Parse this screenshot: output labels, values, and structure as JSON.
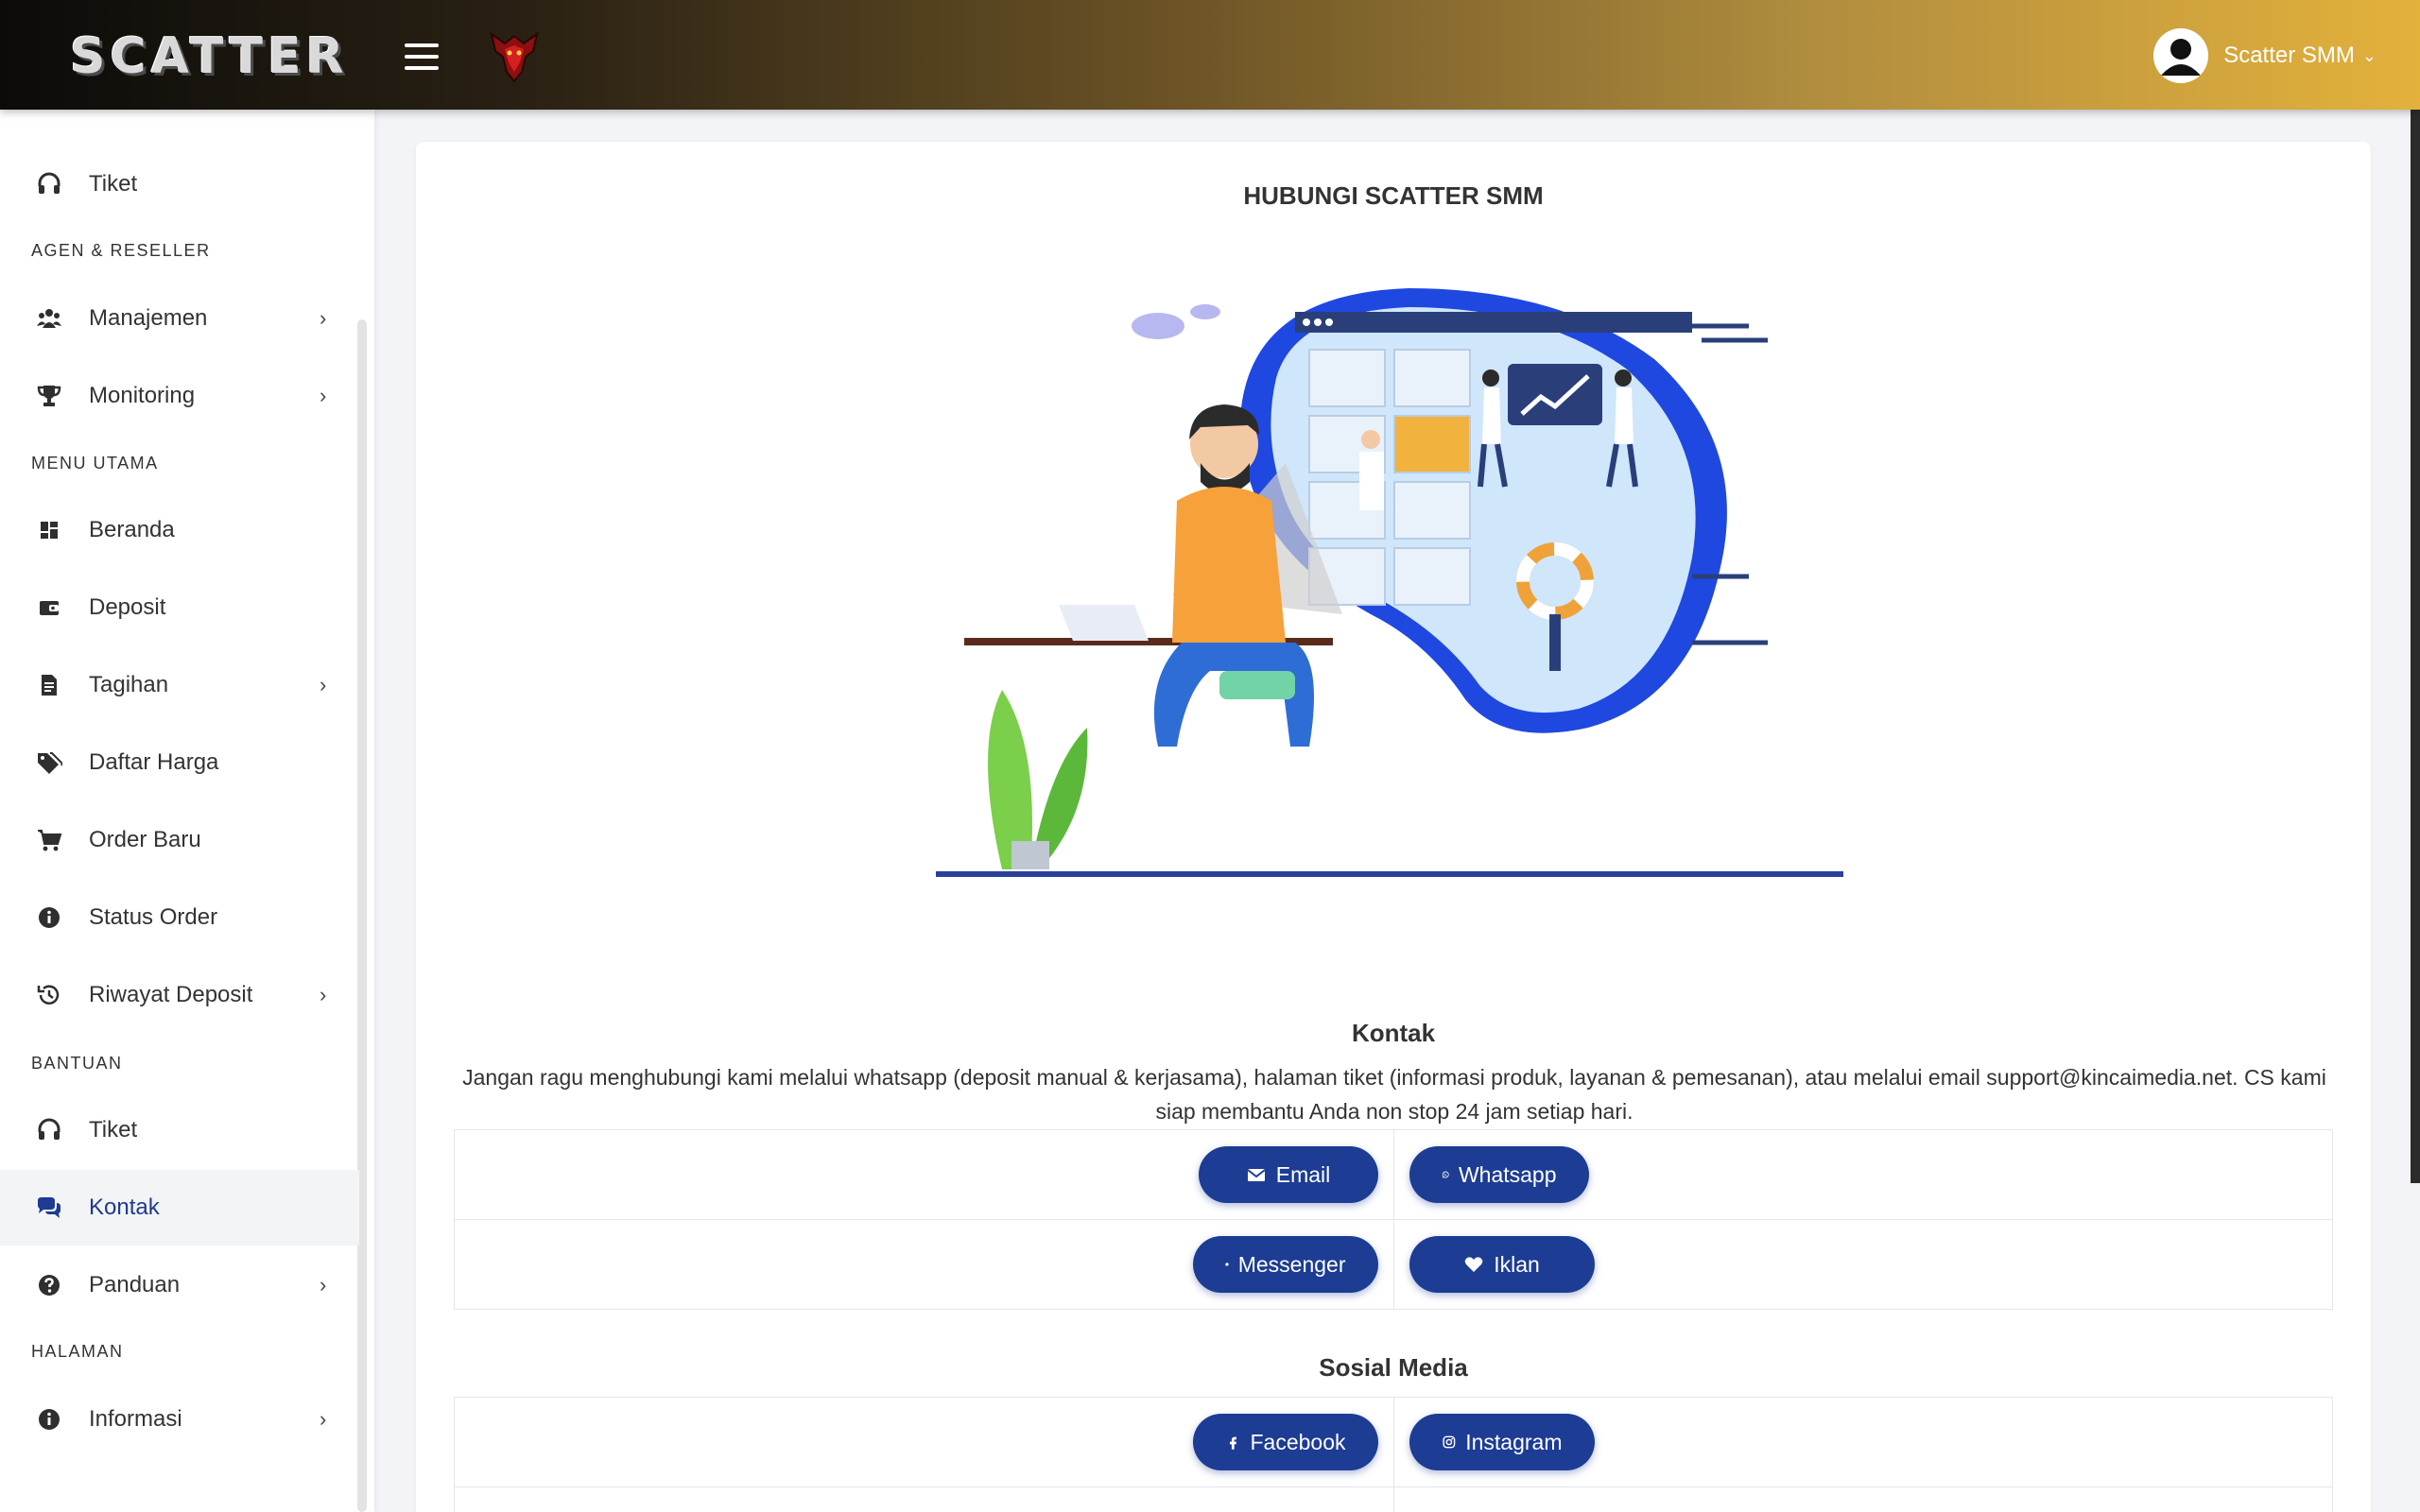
{
  "app": {
    "brand": "SCATTER",
    "user_name": "Scatter SMM"
  },
  "sidebar": {
    "items": [
      {
        "label": "Tiket",
        "icon": "headset-icon"
      },
      {
        "label": "Manajemen",
        "icon": "users-icon",
        "has_children": true
      },
      {
        "label": "Monitoring",
        "icon": "trophy-icon",
        "has_children": true
      },
      {
        "label": "Beranda",
        "icon": "dashboard-icon"
      },
      {
        "label": "Deposit",
        "icon": "wallet-icon"
      },
      {
        "label": "Tagihan",
        "icon": "invoice-icon",
        "has_children": true
      },
      {
        "label": "Daftar Harga",
        "icon": "tags-icon"
      },
      {
        "label": "Order Baru",
        "icon": "cart-icon"
      },
      {
        "label": "Status Order",
        "icon": "info-icon"
      },
      {
        "label": "Riwayat Deposit",
        "icon": "history-icon",
        "has_children": true
      },
      {
        "label": "Tiket",
        "icon": "headset-icon"
      },
      {
        "label": "Kontak",
        "icon": "chat-icon",
        "active": true
      },
      {
        "label": "Panduan",
        "icon": "question-icon",
        "has_children": true
      },
      {
        "label": "Informasi",
        "icon": "info-icon",
        "has_children": true
      }
    ],
    "headings": [
      "AGEN & RESELLER",
      "MENU UTAMA",
      "BANTUAN",
      "HALAMAN"
    ]
  },
  "main": {
    "title": "HUBUNGI SCATTER SMM",
    "contact": {
      "title": "Kontak",
      "text": "Jangan ragu menghubungi kami melalui whatsapp (deposit manual & kerjasama), halaman tiket (informasi produk, layanan & pemesanan), atau melalui email support@kincaimedia.net. CS kami siap membantu Anda non stop 24 jam setiap hari.",
      "buttons": [
        "Email",
        "Whatsapp",
        "Messenger",
        "Iklan"
      ]
    },
    "social": {
      "title": "Sosial Media",
      "buttons": [
        "Facebook",
        "Instagram"
      ]
    }
  },
  "colors": {
    "accent": "#1d3c94",
    "topbar_end": "#e3b13c"
  }
}
